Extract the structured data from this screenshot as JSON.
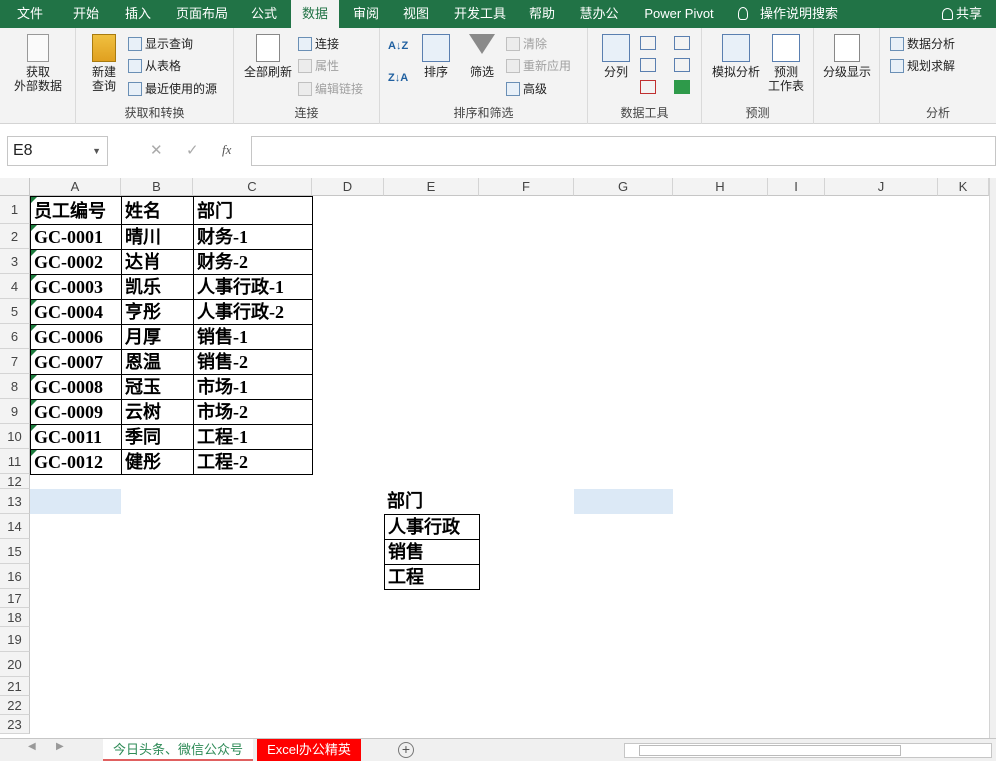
{
  "menu": {
    "tabs": [
      "文件",
      "开始",
      "插入",
      "页面布局",
      "公式",
      "数据",
      "审阅",
      "视图",
      "开发工具",
      "帮助",
      "慧办公",
      "Power Pivot"
    ],
    "active": "数据",
    "tell_me": "操作说明搜索",
    "share": "共享"
  },
  "ribbon": {
    "get_external": "获取\n外部数据",
    "new_query": "新建\n查询",
    "show_query": "显示查询",
    "from_table": "从表格",
    "recent_sources": "最近使用的源",
    "group_get_transform": "获取和转换",
    "refresh_all": "全部刷新",
    "connections": "连接",
    "properties": "属性",
    "edit_links": "编辑链接",
    "group_connections": "连接",
    "sort": "排序",
    "filter": "筛选",
    "clear": "清除",
    "reapply": "重新应用",
    "advanced": "高级",
    "group_sort_filter": "排序和筛选",
    "text_to_columns": "分列",
    "group_data_tools": "数据工具",
    "what_if": "模拟分析",
    "forecast_sheet": "预测\n工作表",
    "group_forecast": "预测",
    "outline": "分级显示",
    "data_analysis": "数据分析",
    "solver": "规划求解",
    "group_analysis": "分析"
  },
  "formula_bar": {
    "name_box": "E8",
    "fx": "fx",
    "formula": ""
  },
  "columns": [
    "A",
    "B",
    "C",
    "D",
    "E",
    "F",
    "G",
    "H",
    "I",
    "J",
    "K"
  ],
  "rows": [
    "1",
    "2",
    "3",
    "4",
    "5",
    "6",
    "7",
    "8",
    "9",
    "10",
    "11",
    "12",
    "13",
    "14",
    "15",
    "16",
    "17",
    "18",
    "19",
    "20",
    "21",
    "22",
    "23"
  ],
  "table": {
    "header": [
      "员工编号",
      "姓名",
      "部门"
    ],
    "rows": [
      [
        "GC-0001",
        "晴川",
        "财务-1"
      ],
      [
        "GC-0002",
        "达肖",
        "财务-2"
      ],
      [
        "GC-0003",
        "凯乐",
        "人事行政-1"
      ],
      [
        "GC-0004",
        "亨彤",
        "人事行政-2"
      ],
      [
        "GC-0006",
        "月厚",
        "销售-1"
      ],
      [
        "GC-0007",
        "恩温",
        "销售-2"
      ],
      [
        "GC-0008",
        "冠玉",
        "市场-1"
      ],
      [
        "GC-0009",
        "云树",
        "市场-2"
      ],
      [
        "GC-0011",
        "季同",
        "工程-1"
      ],
      [
        "GC-0012",
        "健彤",
        "工程-2"
      ]
    ]
  },
  "criteria": {
    "header": "部门",
    "items": [
      "人事行政",
      "销售",
      "工程"
    ]
  },
  "sheets": {
    "tab1": "今日头条、微信公众号",
    "tab2": "Excel办公精英",
    "add": "+"
  },
  "colors": {
    "brand": "#217346",
    "tab2_bg": "#ff0000",
    "highlight": "#dce9f6"
  }
}
